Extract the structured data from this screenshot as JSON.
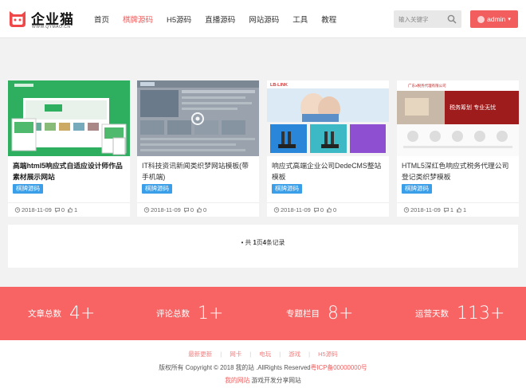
{
  "brand": {
    "name": "企业猫",
    "sub": "WWW.QYMAO.CN",
    "accent": "#f25858"
  },
  "nav": [
    {
      "label": "首页",
      "active": false
    },
    {
      "label": "棋牌源码",
      "active": true
    },
    {
      "label": "H5源码",
      "active": false
    },
    {
      "label": "直播源码",
      "active": false
    },
    {
      "label": "网站源码",
      "active": false
    },
    {
      "label": "工具",
      "active": false
    },
    {
      "label": "教程",
      "active": false
    }
  ],
  "search": {
    "placeholder": "输入关键字",
    "icon": "search-icon"
  },
  "user": {
    "name": "admin",
    "icon": "chevron-down-icon"
  },
  "cards": [
    {
      "title": "高端html5响应式自适应设计师作品素材展示网站",
      "tag": "棋牌源码",
      "date": "2018-11-09",
      "comments": "0",
      "likes": "1"
    },
    {
      "title": "IT科技资讯新闻类织梦网站模板(带手机端)",
      "tag": "棋牌源码",
      "date": "2018-11-09",
      "comments": "0",
      "likes": "0"
    },
    {
      "title": "响应式高端企业公司DedeCMS整站模板",
      "tag": "棋牌源码",
      "date": "2018-11-09",
      "comments": "0",
      "likes": "0"
    },
    {
      "title": "HTML5深红色响应式税务代理公司登记类织梦模板",
      "tag": "棋牌源码",
      "date": "2018-11-09",
      "comments": "1",
      "likes": "1"
    }
  ],
  "thumb_text": {
    "card3_logo": "LB-LINK",
    "card4_title": "广东x税务代理有限公司",
    "card4_slogan": "税务筹划 专业无忧"
  },
  "pager": {
    "prefix": "共",
    "pages": "1",
    "mid": "页",
    "records": "4",
    "suffix": "条记录"
  },
  "stats": [
    {
      "label": "文章总数",
      "value": "4+"
    },
    {
      "label": "评论总数",
      "value": "1+"
    },
    {
      "label": "专题栏目",
      "value": "8+"
    },
    {
      "label": "运营天数",
      "value": "113+"
    }
  ],
  "footer": {
    "links": [
      "最新更新",
      "网卡",
      "电玩",
      "游戏",
      "H5源码"
    ],
    "copyright": "版权所有 Copyright © 2018 我的站 .AllRights Reserved",
    "icp": "粤ICP备00000000号",
    "site_link": "我的网站",
    "site_text": "游戏开发分享网站"
  },
  "colors": {
    "stats_bg": "#f86464",
    "tag_bg": "#3b9ee8",
    "header_bg": "#ffffff"
  }
}
